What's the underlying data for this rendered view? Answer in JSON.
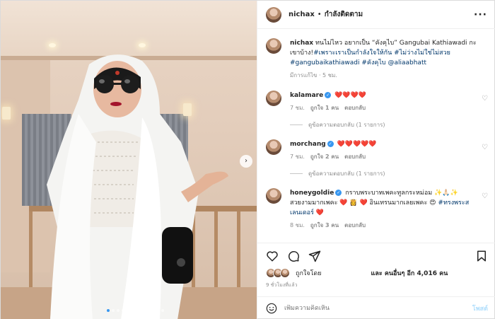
{
  "post": {
    "header": {
      "username": "nichax",
      "separator": "•",
      "follow_label": "กำลังติดตาม",
      "more_icon": "ellipsis-icon"
    },
    "caption": {
      "username": "nichax",
      "text": "ทนไม่ไหว อยากเป็น “คังคุไบ” Gangubai Kathiawadi กะเขาบ้าง!",
      "hashtags_line1": "#เพราะเราเป็นกำลังใจให้กัน #ไม่ว่างไม่ใช่ไม่สวย",
      "hashtags_line2": "#gangubaikathiawadi #คังคุไบ @aliaabhatt",
      "meta": "มีการแก้ไข · 5 ชม."
    },
    "comments": [
      {
        "username": "kalamare",
        "text": "❤️❤️❤️❤️",
        "time": "7 ชม.",
        "likes": "ถูกใจ 1 คน",
        "reply": "ตอบกลับ",
        "view_replies": "ดูข้อความตอบกลับ (1 รายการ)"
      },
      {
        "username": "morchang",
        "text": "❤️❤️❤️❤️❤️",
        "time": "7 ชม.",
        "likes": "ถูกใจ 2 คน",
        "reply": "ตอบกลับ",
        "view_replies": "ดูข้อความตอบกลับ (1 รายการ)"
      },
      {
        "username": "honeygoldie",
        "text_part1": "กราบพระบาทเพคะทูลกระหม่อม ✨🙏🏻✨",
        "text_part2": "สวยงามมากเพคะ ❤️ 👸 ❤️ อินเทรนมากเลยเพคะ 😍",
        "hashtag": "#ทรงพระสเลนเดอร์",
        "text_end": "❤️",
        "time": "8 ชม.",
        "likes": "ถูกใจ 3 คน",
        "reply": "ตอบกลับ"
      }
    ],
    "likes": {
      "liked_by": "ถูกใจโดย",
      "and_others": "และ คนอื่นๆ อีก 4,016 คน"
    },
    "time_ago": "9 ชั่วโมงที่แล้ว",
    "comment_box": {
      "placeholder": "เพิ่มความคิดเห็น",
      "post_label": "โพสต์"
    },
    "carousel": {
      "next_icon": "chevron-right-icon",
      "dot_count": 12,
      "active_index": 0
    }
  }
}
